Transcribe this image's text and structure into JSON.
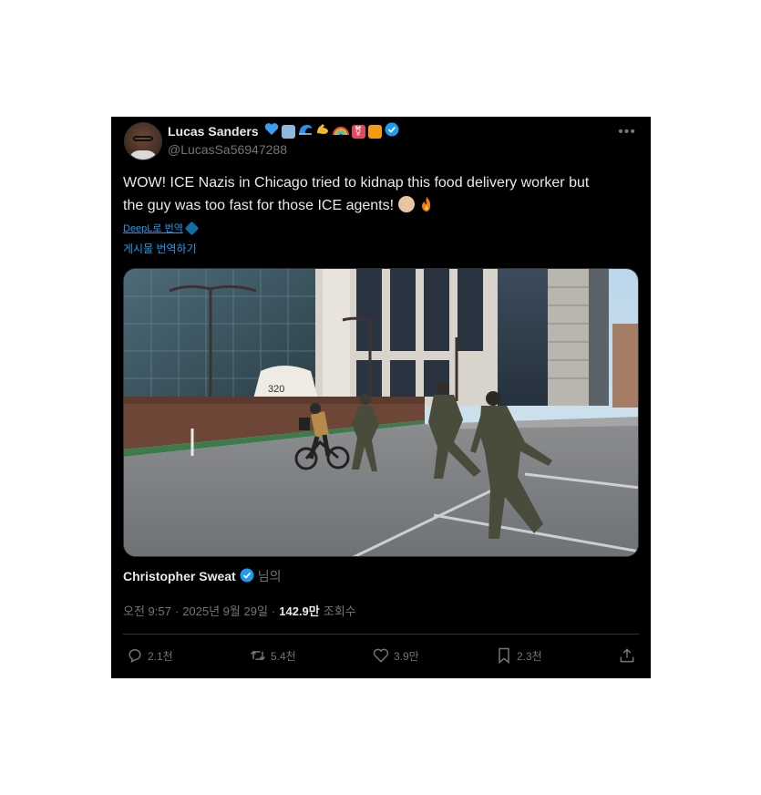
{
  "author": {
    "display_name": "Lucas Sanders",
    "handle": "@LucasSa56947288",
    "emoji_badges": [
      "blue-heart",
      "ballot-box",
      "wave",
      "flexed-biceps",
      "rainbow",
      "transgender-symbol",
      "orange-square"
    ]
  },
  "tweet": {
    "text_line1": "WOW! ICE Nazis in Chicago tried to kidnap this food delivery worker but",
    "text_line2": "the guy was too fast for those ICE agents!",
    "trailing_emojis": [
      "clapping-hands",
      "fire"
    ]
  },
  "deepl_label": "DeepL로 번역",
  "translate_label": "게시물 번역하기",
  "media": {
    "building_sign": "320"
  },
  "quoted": {
    "name": "Christopher Sweat",
    "suffix": "님의"
  },
  "meta": {
    "time": "오전 9:57",
    "separator": "·",
    "date": "2025년 9월 29일",
    "views": "142.9만",
    "views_label": "조회수"
  },
  "actions": {
    "replies": "2.1천",
    "reposts": "5.4천",
    "likes": "3.9만",
    "bookmarks": "2.3천"
  },
  "colors": {
    "background": "#000000",
    "text": "#e7e9ea",
    "muted": "#71767b",
    "accent": "#1d9bf0"
  }
}
